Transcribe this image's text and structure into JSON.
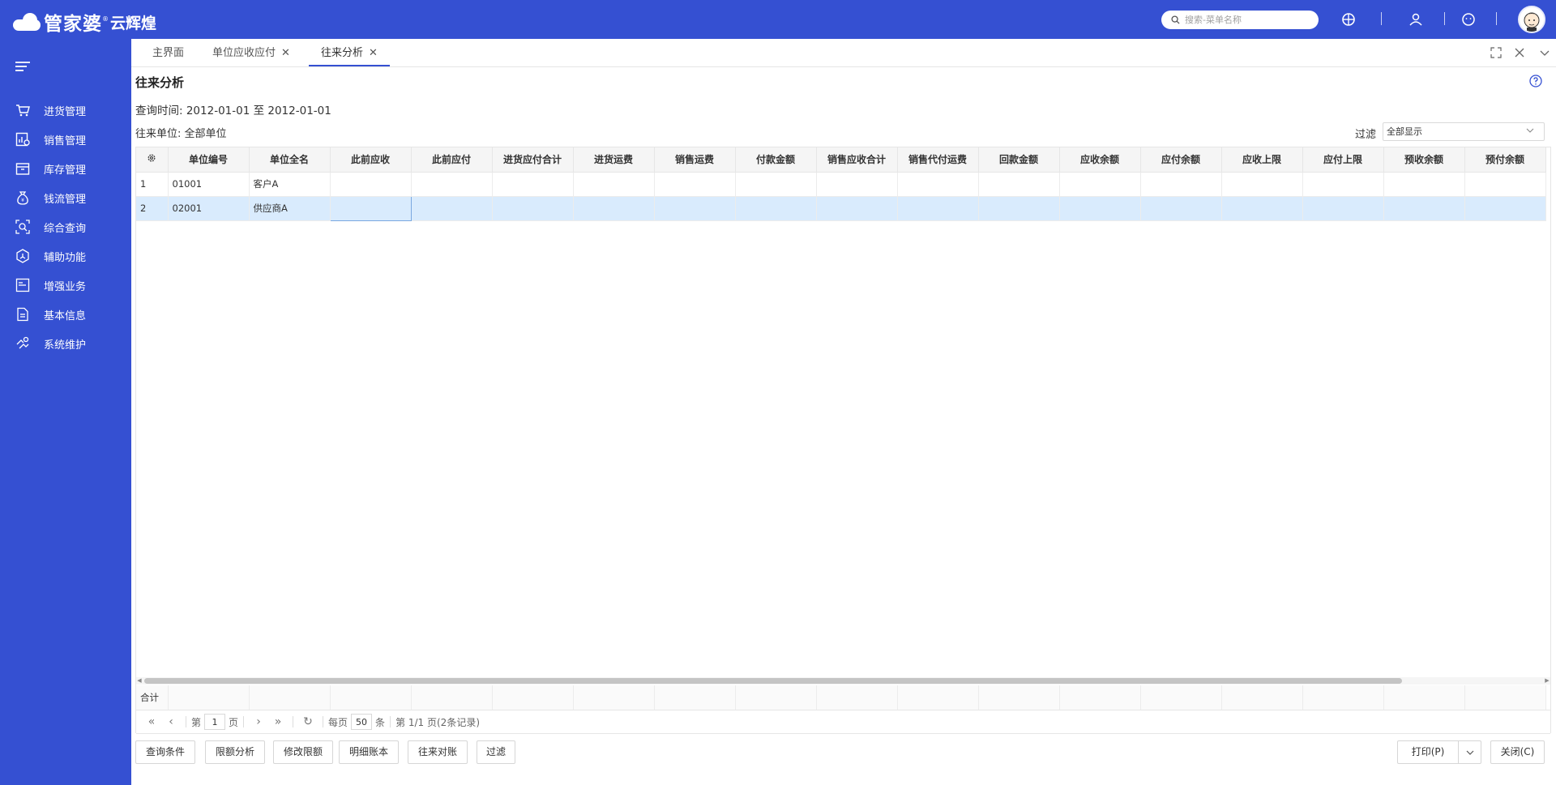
{
  "app": {
    "logo_main": "管家婆",
    "logo_reg": "®",
    "logo_sub": "云辉煌",
    "search_placeholder": "搜索-菜单名称"
  },
  "sidebar": {
    "items": [
      {
        "label": "进货管理",
        "icon": "shopping-cart-icon"
      },
      {
        "label": "销售管理",
        "icon": "sales-chart-icon"
      },
      {
        "label": "库存管理",
        "icon": "inventory-box-icon"
      },
      {
        "label": "钱流管理",
        "icon": "money-bag-icon"
      },
      {
        "label": "综合查询",
        "icon": "query-scan-icon"
      },
      {
        "label": "辅助功能",
        "icon": "hexagon-tool-icon"
      },
      {
        "label": "增强业务",
        "icon": "enhanced-business-icon"
      },
      {
        "label": "基本信息",
        "icon": "document-info-icon"
      },
      {
        "label": "系统维护",
        "icon": "system-maintain-icon"
      }
    ]
  },
  "tabs": [
    {
      "label": "主界面",
      "closable": false
    },
    {
      "label": "单位应收应付",
      "closable": true
    },
    {
      "label": "往来分析",
      "closable": true,
      "active": true
    }
  ],
  "close_glyph": "✕",
  "page": {
    "title": "往来分析",
    "query_time": "查询时间: 2012-01-01 至 2012-01-01",
    "unit_line": "往来单位: 全部单位",
    "filter_label": "过滤",
    "filter_value": "全部显示"
  },
  "table": {
    "columns": [
      "单位编号",
      "单位全名",
      "此前应收",
      "此前应付",
      "进货应付合计",
      "进货运费",
      "销售运费",
      "付款金额",
      "销售应收合计",
      "销售代付运费",
      "回款金额",
      "应收余额",
      "应付余额",
      "应收上限",
      "应付上限",
      "预收余额",
      "预付余额"
    ],
    "rows": [
      {
        "idx": "1",
        "cells": [
          "01001",
          "客户A",
          "",
          "",
          "",
          "",
          "",
          "",
          "",
          "",
          "",
          "",
          "",
          "",
          "",
          "",
          ""
        ]
      },
      {
        "idx": "2",
        "cells": [
          "02001",
          "供应商A",
          "",
          "",
          "",
          "",
          "",
          "",
          "",
          "",
          "",
          "",
          "",
          "",
          "",
          "",
          ""
        ]
      }
    ],
    "selected_row": 2,
    "sum_label": "合计"
  },
  "pager": {
    "first": "«",
    "prev": "‹",
    "next": "›",
    "last": "»",
    "refresh": "↻",
    "page_prefix": "第",
    "page_value": "1",
    "page_suffix": "页",
    "per_page_prefix": "每页",
    "per_page_value": "50",
    "per_page_suffix": "条",
    "summary": "第 1/1 页(2条记录)"
  },
  "buttons": {
    "query_conditions": "查询条件",
    "limit_analysis": "限额分析",
    "modify_limit": "修改限额",
    "detail_ledger": "明细账本",
    "reconcile": "往来对账",
    "filter": "过滤",
    "print": "打印(P)",
    "close": "关闭(C)"
  }
}
